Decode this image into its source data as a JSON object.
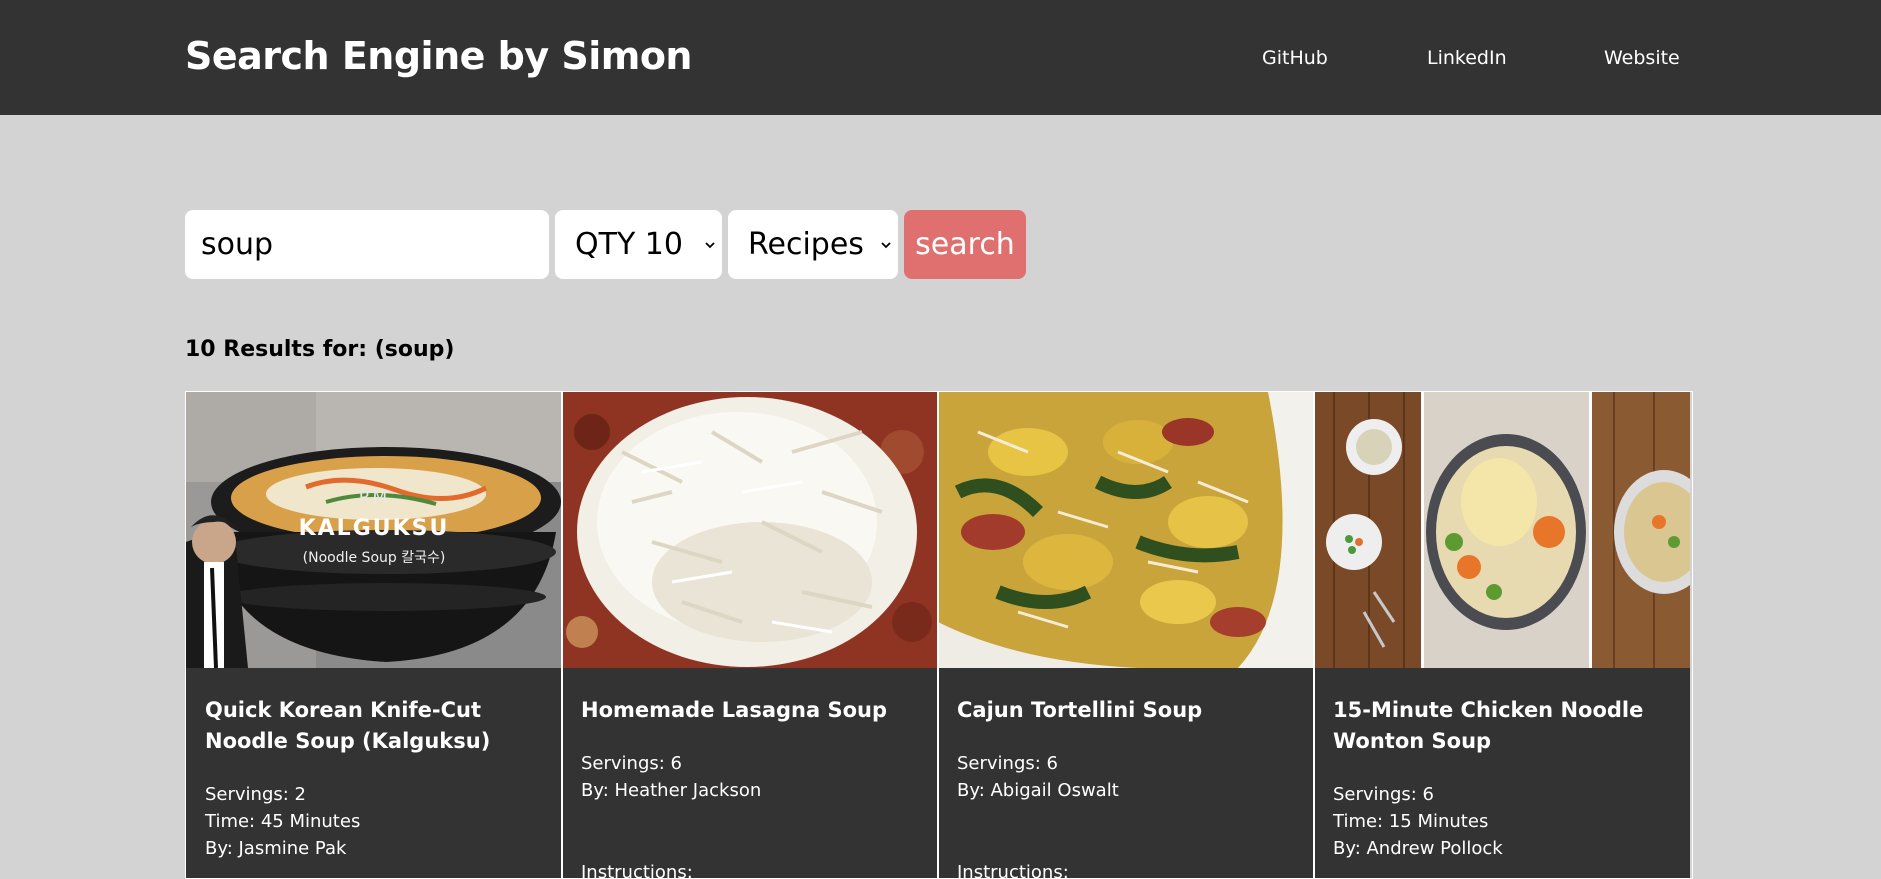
{
  "header": {
    "title": "Search Engine by Simon",
    "nav": [
      "GitHub",
      "LinkedIn",
      "Website"
    ]
  },
  "search": {
    "query": "soup",
    "qty": "QTY 10",
    "type": "Recipes",
    "button_label": "search"
  },
  "results": {
    "label": "10 Results for: (soup)"
  },
  "cards": [
    {
      "title": "Quick Korean Knife-Cut Noodle Soup (Kalguksu)",
      "servings": "Servings: 2",
      "time": "Time: 45 Minutes",
      "author": "By: Jasmine Pak",
      "image": {
        "name": "korean-kalguksu-photo",
        "overlay_lines": [
          "RM",
          "KALGUKSU",
          "(Noodle Soup 칼국수)"
        ]
      }
    },
    {
      "title": "Homemade Lasagna Soup",
      "servings": "Servings: 6",
      "author": "By: Heather Jackson",
      "instructions": "Instructions:",
      "image": {
        "name": "lasagna-soup-photo"
      }
    },
    {
      "title": "Cajun Tortellini Soup",
      "servings": "Servings: 6",
      "author": "By: Abigail Oswalt",
      "instructions": "Instructions:",
      "image": {
        "name": "tortellini-soup-photo"
      }
    },
    {
      "title": "15-Minute Chicken Noodle Wonton Soup",
      "servings": "Servings: 6",
      "time": "Time: 15 Minutes",
      "author": "By: Andrew Pollock",
      "image": {
        "name": "wonton-soup-photo"
      }
    }
  ],
  "colors": {
    "header_bg": "#333333",
    "page_bg": "#d3d3d3",
    "card_bg": "#333333",
    "search_button_bg": "#e07070",
    "text_on_dark": "#ffffff"
  }
}
